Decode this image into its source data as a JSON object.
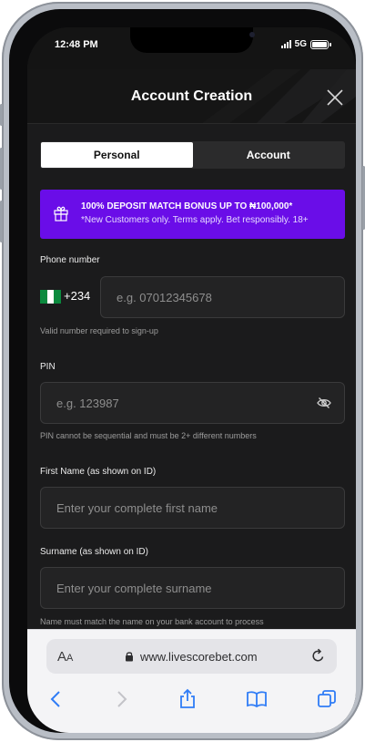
{
  "status": {
    "time": "12:48 PM",
    "network": "5G"
  },
  "header": {
    "title": "Account Creation"
  },
  "tabs": [
    {
      "label": "Personal"
    },
    {
      "label": "Account"
    }
  ],
  "promo": {
    "headline": "100% DEPOSIT MATCH BONUS UP TO ₦100,000*",
    "subline": "*New Customers only. Terms apply. Bet responsibly. 18+"
  },
  "form": {
    "phone": {
      "label": "Phone number",
      "country_code": "+234",
      "placeholder": "e.g. 07012345678",
      "hint": "Valid number required to sign-up"
    },
    "pin": {
      "label": "PIN",
      "placeholder": "e.g. 123987",
      "hint": "PIN cannot be sequential and must be 2+ different numbers"
    },
    "first_name": {
      "label": "First Name (as shown on ID)",
      "placeholder": "Enter your complete first name"
    },
    "surname": {
      "label": "Surname (as shown on ID)",
      "placeholder": "Enter your complete surname",
      "hint": "Name must match the name on your bank account to process"
    }
  },
  "browser": {
    "aa_label_big": "A",
    "aa_label_small": "A",
    "url": "www.livescorebet.com"
  },
  "colors": {
    "promo_bg": "#6a0de8",
    "flag_green": "#0b8a3e",
    "ios_blue": "#2f7cf6"
  }
}
